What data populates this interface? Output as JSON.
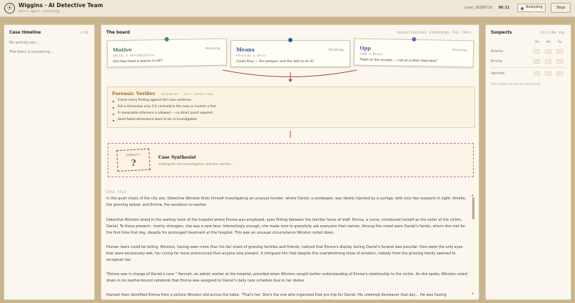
{
  "header": {
    "logo_glyph": "⦿",
    "title": "Wiggins · AI Detective Team",
    "subtitle": "multi-agent reasoning",
    "case_id": "case_20260718",
    "timer": "00:11",
    "status": "Analyzing",
    "stop_label": "Stop",
    "status_color": "#3a6fb0"
  },
  "timeline": {
    "title": "Case timeline",
    "tag": "LIVE",
    "items": [
      "No activity yet…",
      "The team is convening…"
    ]
  },
  "board": {
    "title": "The board",
    "tag": "INVESTIGATORS EXAMINING THE CASE…",
    "dimensions": [
      {
        "name": "Motive",
        "sub": "SOCIAL & PSYCHOLOGICAL",
        "question": "Did they have a reason to kill?",
        "status": "thinking…",
        "color": "#3f7a4a",
        "pin": "#3f8a4a"
      },
      {
        "name": "Means",
        "sub": "PHYSICAL & SKILL",
        "question": "Could they — the weapon and the skill to do it?",
        "status": "thinking…",
        "color": "#2f5d9a",
        "pin": "#2f5d9a"
      },
      {
        "name": "Opp",
        "sub": "TIME & PLACE",
        "question": "There at the murder — not at a later interview?",
        "status": "thinking…",
        "color": "#6a4fa0",
        "pin": "#7a5ab0"
      }
    ],
    "verifier": {
      "title": "Forensic Verifier",
      "sub": "GROUNDING · SELF-CORRECTION",
      "rules": [
        "Check every finding against the case evidence.",
        "Fail a dimension only if it contradicts the case or invents a fact.",
        "A reasonable inference is allowed — no direct proof required.",
        "Send failed dimensions back to be re-investigated."
      ]
    },
    "synthesist": {
      "verdict_label": "VERDICT",
      "verdict_mark": "?",
      "title": "Case Synthesist",
      "subtitle": "waiting for the investigators and the verifier…"
    },
    "case_file": {
      "label": "CASE FILE",
      "paragraphs": [
        "In the quiet chaos of the city zoo, Detective Winston finds himself investigating an unusual murder, where Daniel, a zookeeper, was fatally injected by a syringe, with only two suspects in sight: Amelia, the grieving widow, and Emma, the secretive co-worker.",
        "Detective Winston stood in the waiting room of the hospital where Emma was employed, eyes flitting between the familiar faces of staff. Emma, a nurse, introduced herself as the sister of the victim, Daniel. To those present-- mainly strangers, she was a new face. Interestingly enough, she made sure to gracefully ask everyone their names. Among the crowd were Daniel's family, whom she met for the first time that day, despite his prolonged treatment at the hospital. This was an unusual circumstance Winston noted down.",
        "Human tears could be telling. Winston, having seen more than his fair share of grieving families and friends, noticed that Emma's display during Daniel's funeral was peculiar. Hers were the only eyes that were excessively wet, her crying far more pronounced than anyone else present. It intrigued him that despite this overwhelming show of emotion, nobody from the grieving family seemed to recognize her.",
        "\"Emma was in charge of Daniel's care,\" Hannah, an admin worker at the hospital, provided when Winston sought better understanding of Emma's relationship to the victim. As she spoke, Winston noted down in his leather-bound notebook that Emma was assigned to Daniel's daily care schedule due to her duties.",
        "Hannah then identified Emma from a picture Winston slid across the table. \"That's her. She's the one who organized that pre-trip for Daniel. His unkempt demeanor that day… He was having"
      ]
    }
  },
  "suspects": {
    "title": "Suspects",
    "tag": "FILLING IN…",
    "columns": [
      "Mo",
      "Me",
      "Op"
    ],
    "rows": [
      {
        "name": "Amelia",
        "cells": [
          "—",
          "—",
          "—"
        ]
      },
      {
        "name": "Emma",
        "cells": [
          "—",
          "—",
          "—"
        ]
      },
      {
        "name": "Verified",
        "cells": [
          "—",
          "—",
          "—"
        ]
      }
    ],
    "hint": "Fills a filled cell for the reasoning"
  }
}
